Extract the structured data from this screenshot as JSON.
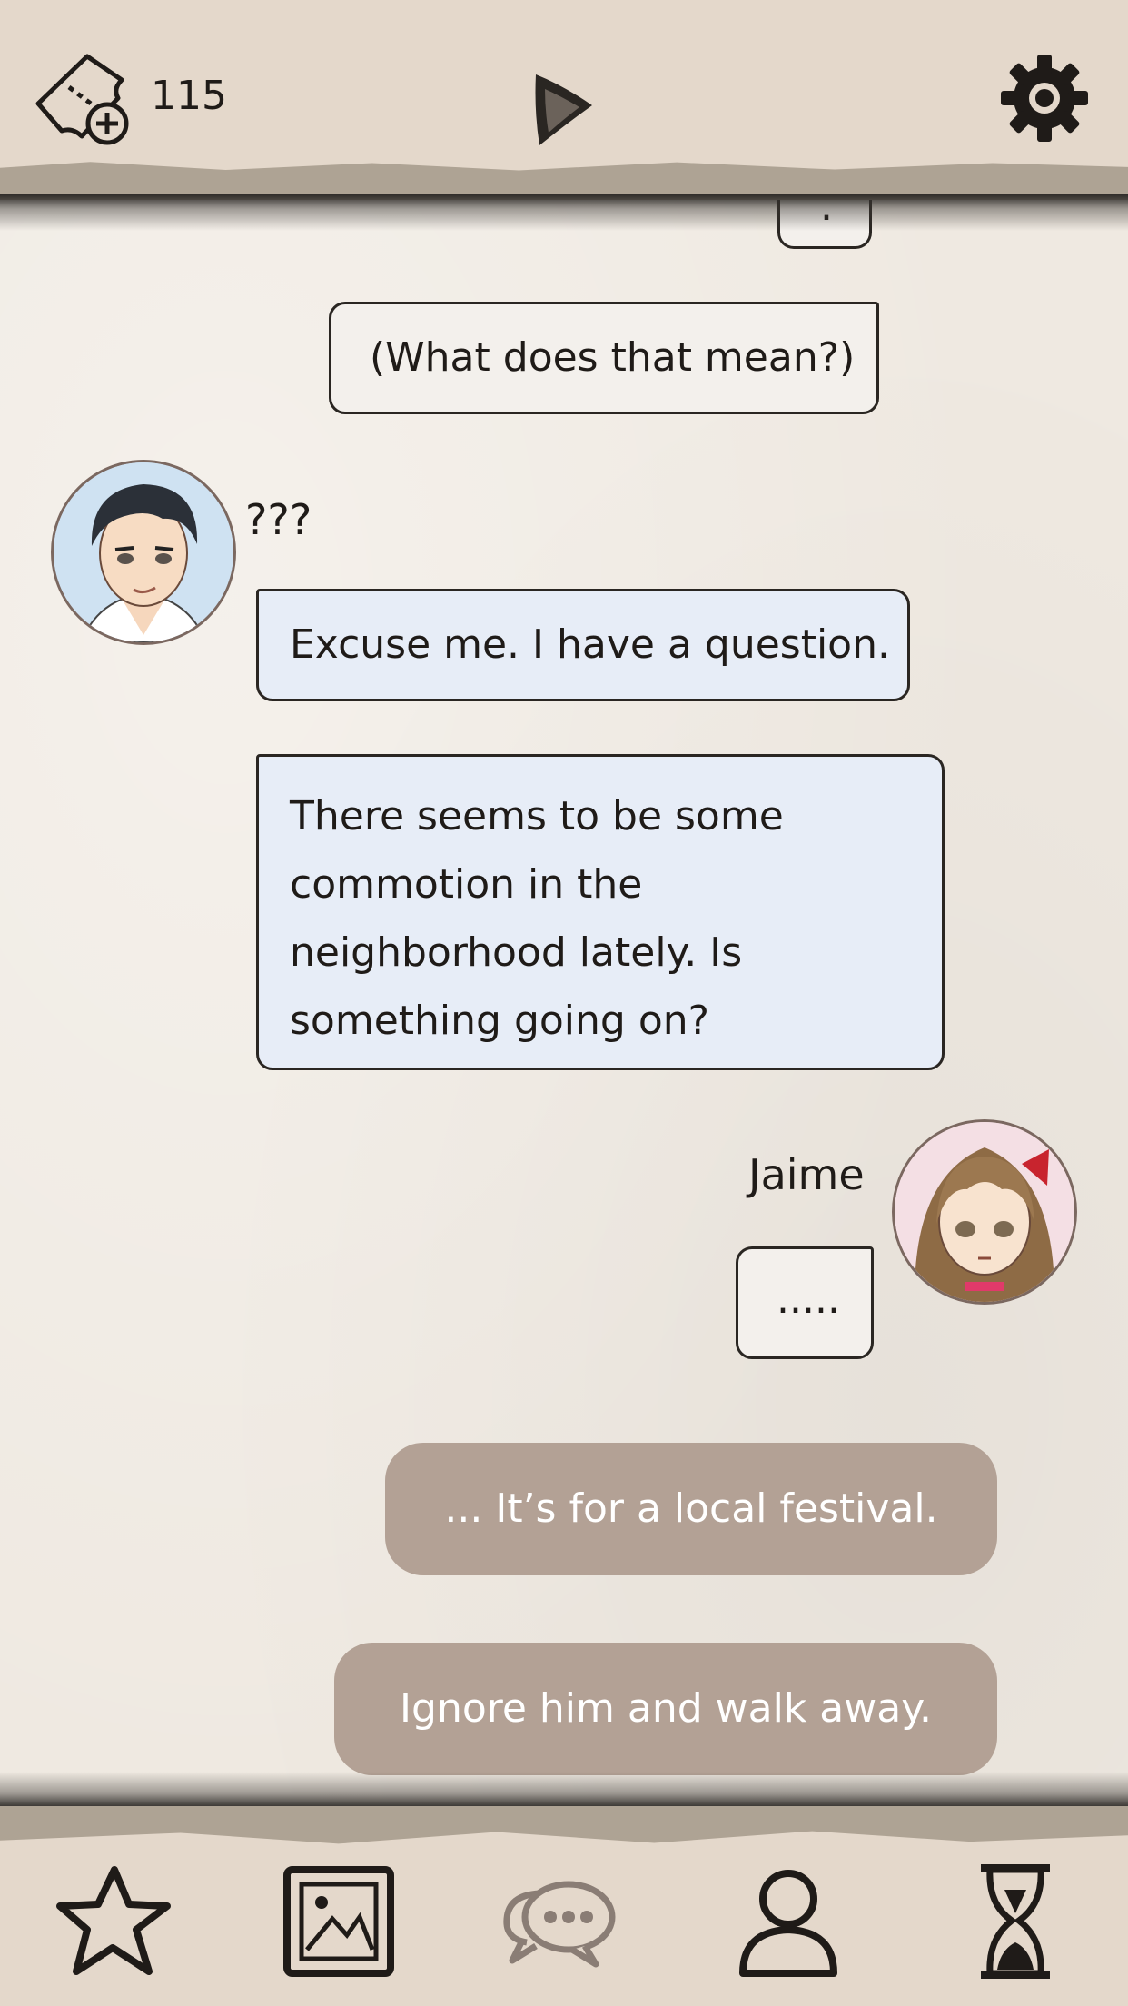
{
  "header": {
    "ticket_icon": "ticket-plus-icon",
    "ticket_count": "115",
    "center_icon": "play-triangle-icon",
    "settings_icon": "gear-icon"
  },
  "chat": {
    "partial_bubble_text": ".",
    "player_thought": "(What does that mean?)",
    "other_name": "???",
    "other_msg_1": "Excuse me. I have a question.",
    "other_msg_2_lines": [
      "There seems to be some",
      "commotion in the",
      "neighborhood lately. Is",
      "something going on?"
    ],
    "player_name": "Jaime",
    "player_reply": "....."
  },
  "choices": [
    "... It’s for a local festival.",
    "Ignore him and walk away."
  ],
  "nav": [
    {
      "icon": "star-icon"
    },
    {
      "icon": "gallery-icon"
    },
    {
      "icon": "chat-icon"
    },
    {
      "icon": "profile-icon"
    },
    {
      "icon": "hourglass-icon"
    }
  ],
  "colors": {
    "bar": "#e4d8cb",
    "player_bubble": "#f3f0ec",
    "other_bubble": "#e7edf7",
    "choice": "#b3a195",
    "chat_icon_active": "#8a7d75"
  }
}
